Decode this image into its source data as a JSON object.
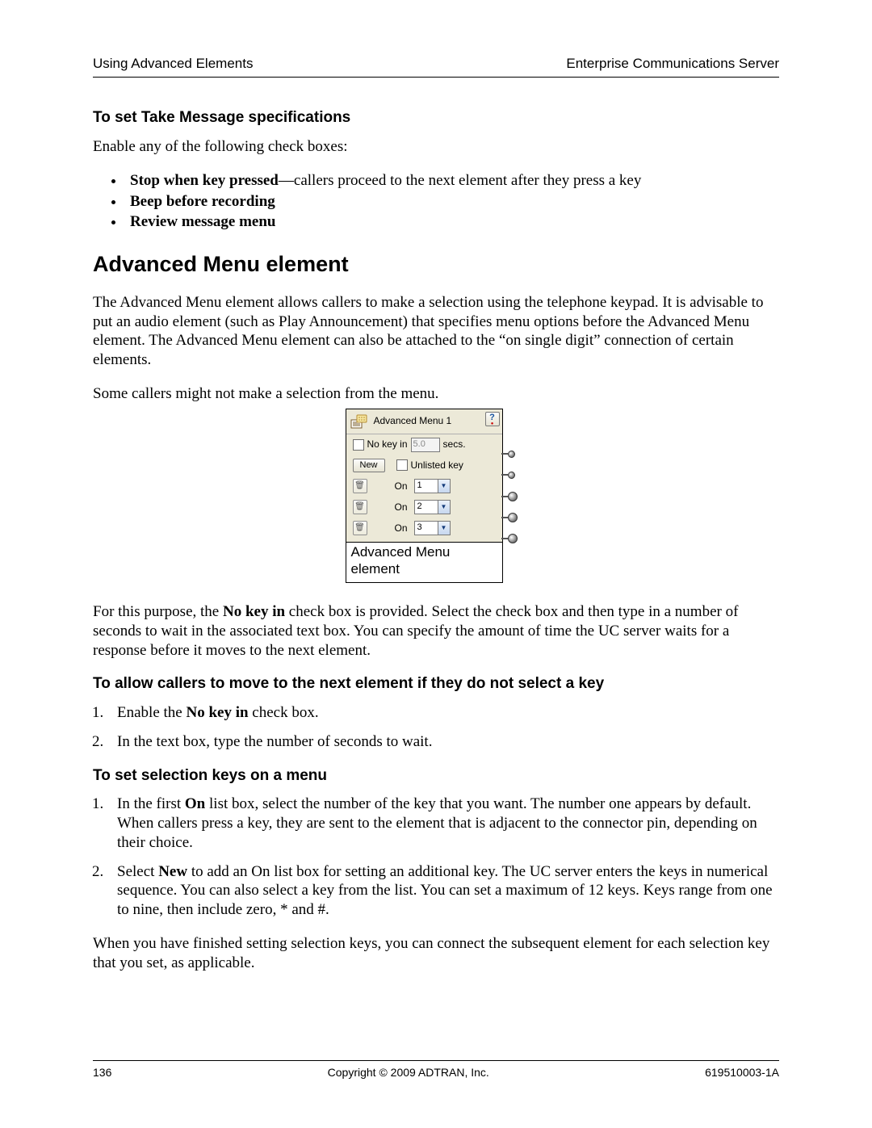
{
  "header": {
    "left": "Using Advanced Elements",
    "right": "Enterprise Communications Server"
  },
  "section1": {
    "title": "To set Take Message specifications",
    "intro": "Enable any of the following check boxes:",
    "bullets": {
      "b1_bold": "Stop when key pressed",
      "b1_rest": "—callers proceed to the next element after they press a key",
      "b2": "Beep before recording",
      "b3": "Review message menu"
    }
  },
  "h2": "Advanced Menu element",
  "para1": "The Advanced Menu element allows callers to make a selection using the telephone keypad. It is advisable to put an audio element (such as Play Announcement) that specifies menu options before the Advanced Menu element. The Advanced Menu element can also be attached to the “on single digit” connection of certain elements.",
  "para2": "Some callers might not make a selection from the menu.",
  "figure": {
    "title": "Advanced Menu 1",
    "nokey_label_pre": "No key in",
    "nokey_value": "5.0",
    "nokey_label_post": "secs.",
    "new_btn": "New",
    "unlisted": "Unlisted key",
    "on_label": "On",
    "rows": [
      "1",
      "2",
      "3"
    ],
    "caption": "Advanced Menu element"
  },
  "para3_pre": "For this purpose, the ",
  "para3_bold": "No key in",
  "para3_post": " check box is provided. Select the check box and then type in a number of seconds to wait in the associated text box. You can specify the amount of time the UC server waits for a response before it moves to the next element.",
  "section2": {
    "title": "To allow callers to move to the next element if they do not select a key",
    "step1_pre": "Enable the ",
    "step1_bold": "No key in",
    "step1_post": " check box.",
    "step2": "In the text box, type the number of seconds to wait."
  },
  "section3": {
    "title": "To set selection keys on a menu",
    "step1_pre": "In the first ",
    "step1_bold": "On",
    "step1_post": " list box, select the number of the key that you want. The number one appears by default. When callers press a key, they are sent to the element that is adjacent to the connector pin, depending on their choice.",
    "step2_pre": "Select ",
    "step2_bold": "New",
    "step2_post": " to add an On list box for setting an additional key. The UC server enters the keys in numerical sequence. You can also select a key from the list. You can set a maximum of 12 keys. Keys range from one to nine, then include zero, * and #."
  },
  "para4": "When you have finished setting selection keys, you can connect the subsequent element for each selection key that you set, as applicable.",
  "footer": {
    "page": "136",
    "copyright": "Copyright © 2009 ADTRAN, Inc.",
    "docnum": "619510003-1A"
  }
}
